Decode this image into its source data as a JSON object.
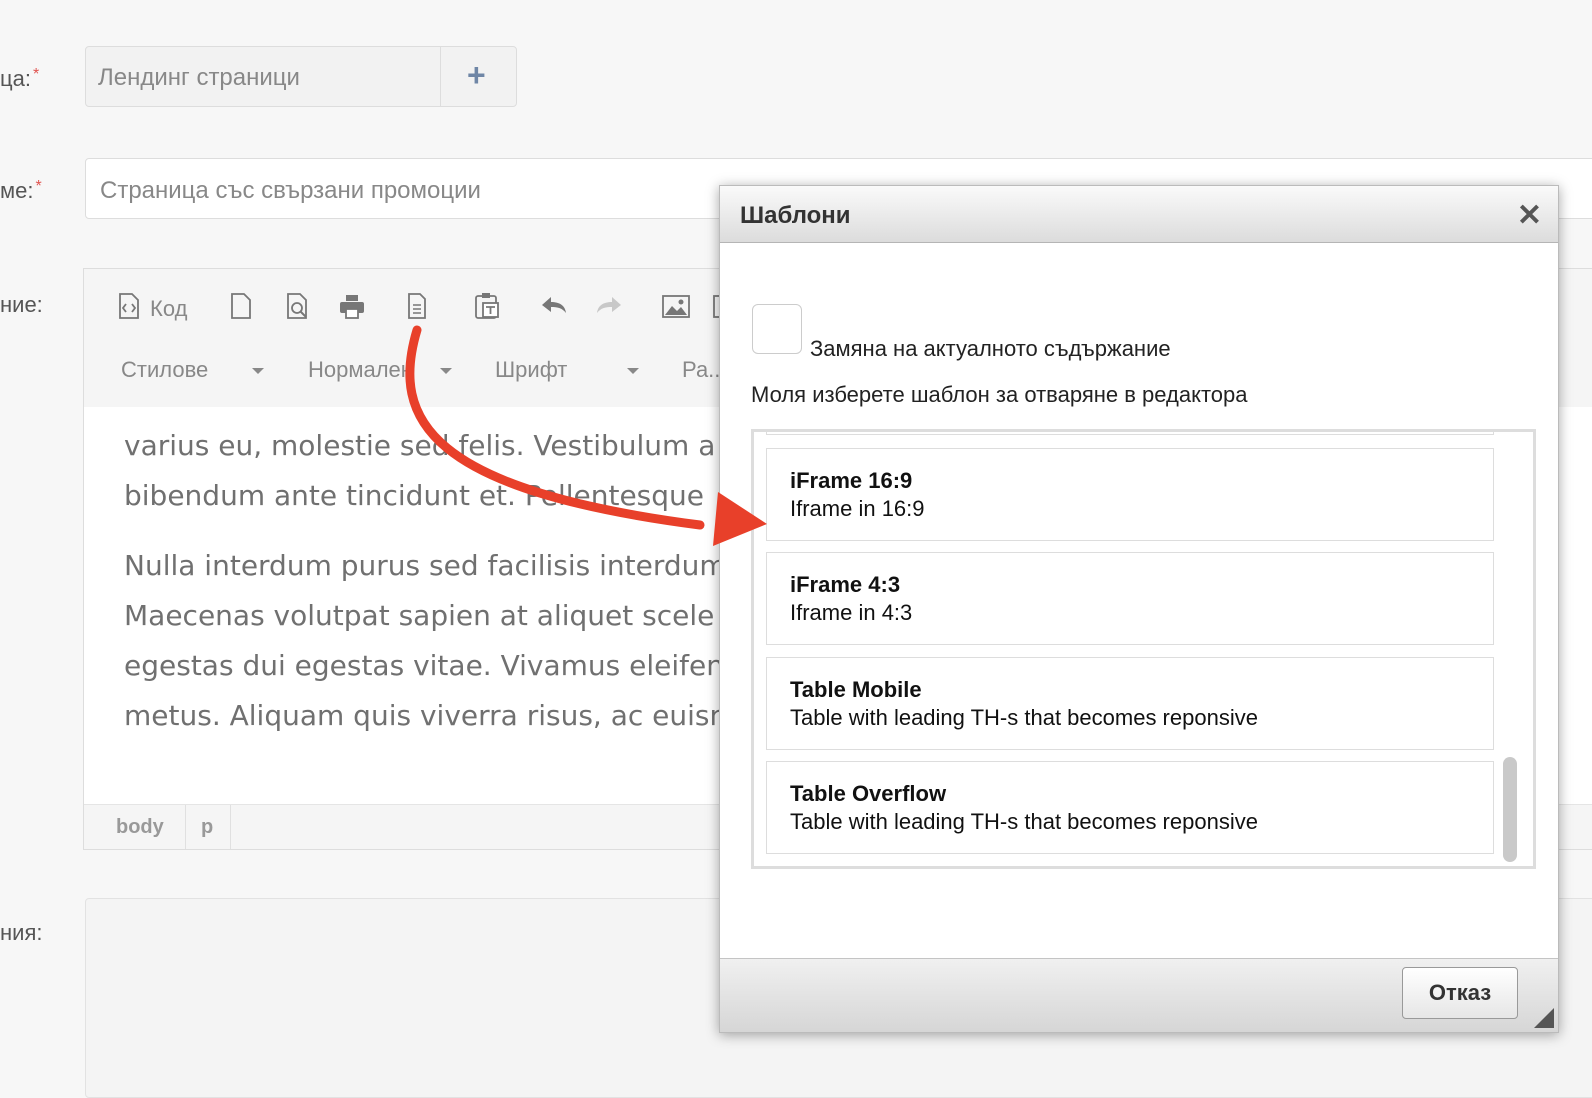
{
  "form": {
    "field1_label": "ца:",
    "field1_required": "*",
    "landing_value": "Лендинг страници",
    "add_symbol": "+",
    "field2_label": "ме:",
    "field2_required": "*",
    "title_value": "Страница със свързани промоции",
    "field3_label": "ние:",
    "field4_label": "ния:"
  },
  "editor": {
    "source_label": "Код",
    "styles_label": "Стилове",
    "format_label": "Нормален",
    "font_label": "Шрифт",
    "size_label": "Ра...",
    "paragraphs": [
      [
        "varius eu, molestie sed felis. Vestibulum a",
        "bibendum ante tincidunt et. Pellentesque"
      ],
      [
        "Nulla interdum purus sed facilisis interdum",
        "Maecenas volutpat sapien at aliquet scele",
        "egestas dui egestas vitae. Vivamus eleifen",
        "metus. Aliquam quis viverra risus, ac euisn"
      ]
    ],
    "path_body": "body",
    "path_p": "p"
  },
  "dialog": {
    "title": "Шаблони",
    "close_symbol": "✕",
    "replace_label": "Замяна на актуалното съдържание",
    "instruction": "Моля изберете шаблон за отваряне в редактора",
    "templates": [
      {
        "title": "iFrame 16:9",
        "description": "Iframe in 16:9"
      },
      {
        "title": "iFrame 4:3",
        "description": "Iframe in 4:3"
      },
      {
        "title": "Table Mobile",
        "description": "Table with leading TH-s that becomes reponsive"
      },
      {
        "title": "Table Overflow",
        "description": "Table with leading TH-s that becomes reponsive"
      }
    ],
    "cancel_label": "Отказ"
  },
  "colors": {
    "arrow": "#e8402a",
    "required": "#e0534f"
  }
}
